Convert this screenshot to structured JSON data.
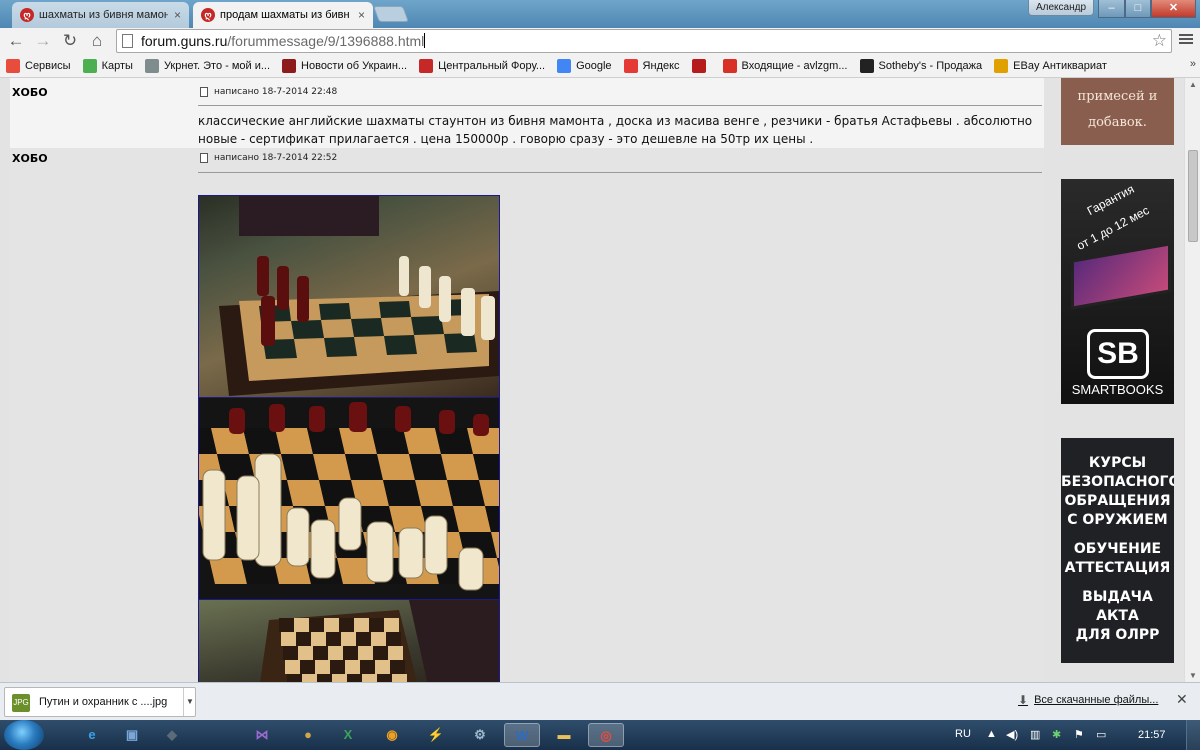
{
  "window": {
    "tabs": [
      {
        "title": "шахматы из бивня мамон",
        "active": false
      },
      {
        "title": "продам шахматы из бивн",
        "active": true
      }
    ],
    "user": "Александр",
    "min": "–",
    "max": "□",
    "close": "✕"
  },
  "toolbar": {
    "back": "←",
    "forward": "→",
    "reload": "↻",
    "home": "⌂",
    "url_host": "forum.guns.ru",
    "url_path": "/forummessage/9/1396888.html",
    "star": "☆"
  },
  "bookmarks": [
    {
      "label": "Сервисы",
      "icon": "apps-icon",
      "color": "#e74c3c"
    },
    {
      "label": "Карты",
      "icon": "maps-icon",
      "color": "#4caf50"
    },
    {
      "label": "Укрнет. Это - мой и...",
      "icon": "ukrnet-icon",
      "color": "#7f8c8d"
    },
    {
      "label": "Новости об Украин...",
      "icon": "news-icon",
      "color": "#8e1b1b"
    },
    {
      "label": "Центральный Фору...",
      "icon": "forum-icon",
      "color": "#c62828"
    },
    {
      "label": "Google",
      "icon": "google-icon",
      "color": "#4285f4"
    },
    {
      "label": "Яндекс",
      "icon": "yandex-icon",
      "color": "#e53935"
    },
    {
      "label": "",
      "icon": "chart-icon",
      "color": "#b71c1c"
    },
    {
      "label": "Входящие - avlzgm...",
      "icon": "gmail-icon",
      "color": "#d93025"
    },
    {
      "label": "Sotheby's - Продажа",
      "icon": "sothebys-icon",
      "color": "#222222"
    },
    {
      "label": "EBay Антиквариат",
      "icon": "ebay-icon",
      "color": "#e0a000"
    }
  ],
  "bookmarks_more": "»",
  "posts": [
    {
      "author": "ХОБО",
      "meta": "написано 18-7-2014 22:48",
      "body": "классические английские шахматы стаунтон из бивня мамонта , доска из масива венге , резчики - братья Астафьевы . абсолютно новые - сертификат прилагается . цена 150000р . говорю сразу - это дешевле на 50тр их цены ."
    },
    {
      "author": "ХОБО",
      "meta": "написано 18-7-2014 22:52",
      "body": ""
    }
  ],
  "ads": {
    "ad1": {
      "line1": "примесей и",
      "line2": "добавок."
    },
    "ad2": {
      "line1": "Гарантия",
      "line2": "от 1 до 12 мес",
      "logo": "SB",
      "brand": "SMARTBOOKS"
    },
    "ad3": {
      "lines": [
        "КУРСЫ",
        "БЕЗОПАСНОГО",
        "ОБРАЩЕНИЯ",
        "С ОРУЖИЕМ",
        "ОБУЧЕНИЕ",
        "АТТЕСТАЦИЯ",
        "ВЫДАЧА АКТА",
        "ДЛЯ ОЛРР"
      ]
    }
  },
  "download_shelf": {
    "item": "Путин и охранник с ....jpg",
    "all": "Все скачанные файлы...",
    "close": "✕"
  },
  "taskbar": {
    "lang": "RU",
    "clock": "21:57",
    "apps": [
      {
        "name": "ie-icon",
        "glyph": "e",
        "color": "#3aa0e8"
      },
      {
        "name": "save-icon",
        "glyph": "▣",
        "color": "#7aa6d8"
      },
      {
        "name": "app-icon",
        "glyph": "◆",
        "color": "#5c6b7a"
      },
      {
        "name": "vs-icon",
        "glyph": "⋈",
        "color": "#9a6ad0"
      },
      {
        "name": "media-icon",
        "glyph": "●",
        "color": "#cfa64a"
      },
      {
        "name": "excel-icon",
        "glyph": "X",
        "color": "#3ca35a"
      },
      {
        "name": "aimp-icon",
        "glyph": "◉",
        "color": "#f0a020"
      },
      {
        "name": "winamp-icon",
        "glyph": "⚡",
        "color": "#f1c232"
      },
      {
        "name": "tool-icon",
        "glyph": "⚙",
        "color": "#9fb7cc"
      },
      {
        "name": "word-icon",
        "glyph": "W",
        "color": "#2b6cc4"
      },
      {
        "name": "folder-icon",
        "glyph": "▬",
        "color": "#e8c15a"
      },
      {
        "name": "chrome-icon",
        "glyph": "◎",
        "color": "#e94b3c"
      }
    ]
  }
}
